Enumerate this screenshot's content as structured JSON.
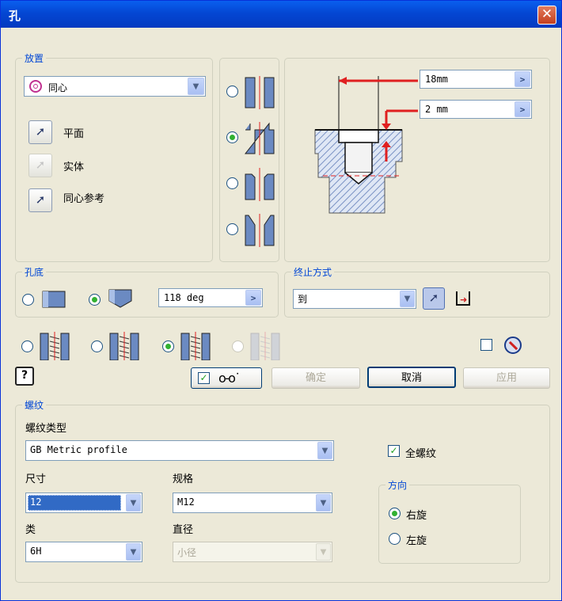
{
  "window": {
    "title": "孔",
    "close_glyph": "✕"
  },
  "placement": {
    "group_label": "放置",
    "type_combo": {
      "value": "同心",
      "icon": "concentric-circle-icon"
    },
    "buttons": [
      {
        "label": "平面",
        "state": "enabled"
      },
      {
        "label": "实体",
        "state": "disabled"
      },
      {
        "label": "同心参考",
        "state": "enabled"
      }
    ]
  },
  "hole_type_options": [
    {
      "name": "simple-hole",
      "selected": false
    },
    {
      "name": "counterbore-hole",
      "selected": true
    },
    {
      "name": "spotface-hole",
      "selected": false
    },
    {
      "name": "countersink-hole",
      "selected": false
    }
  ],
  "preview": {
    "diameter": "18mm",
    "depth": "2 mm",
    "accent_color": "#e02020",
    "hatch_color": "#8aa0cc"
  },
  "drill_point": {
    "group_label": "孔底",
    "options": [
      {
        "name": "flat",
        "selected": false
      },
      {
        "name": "angle",
        "selected": true
      }
    ],
    "angle": "118 deg"
  },
  "termination": {
    "group_label": "终止方式",
    "value": "到"
  },
  "thread_types": [
    {
      "name": "simple",
      "selected": false
    },
    {
      "name": "clearance",
      "selected": false
    },
    {
      "name": "tapped",
      "selected": true
    },
    {
      "name": "taper-tapped",
      "selected": false,
      "disabled": true
    }
  ],
  "buttons": {
    "ok": "确定",
    "cancel": "取消",
    "apply": "应用",
    "help": "?"
  },
  "threads": {
    "group_label": "螺纹",
    "thread_type_label": "螺纹类型",
    "thread_type": "GB Metric profile",
    "full_depth_label": "全螺纹",
    "full_depth_checked": true,
    "size_label": "尺寸",
    "size": "12",
    "designation_label": "规格",
    "designation": "M12",
    "class_label": "类",
    "class": "6H",
    "diameter_label": "直径",
    "diameter": "小径",
    "direction": {
      "group_label": "方向",
      "right_label": "右旋",
      "left_label": "左旋",
      "right_selected": true
    }
  }
}
